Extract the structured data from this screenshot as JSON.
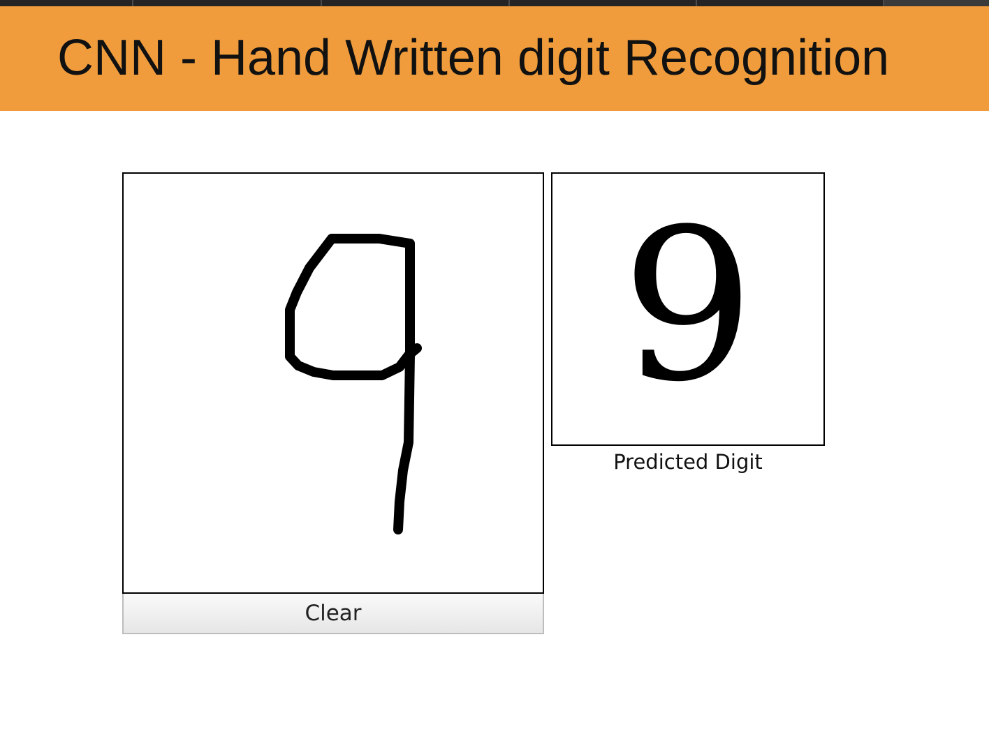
{
  "header": {
    "title": "CNN - Hand Written digit Recognition",
    "background_color": "#f09c3c"
  },
  "canvas": {
    "stroke_color": "#000000",
    "drawn_digit_icon": "handwritten-nine"
  },
  "controls": {
    "clear_label": "Clear"
  },
  "prediction": {
    "digit": "9",
    "caption": "Predicted Digit"
  }
}
